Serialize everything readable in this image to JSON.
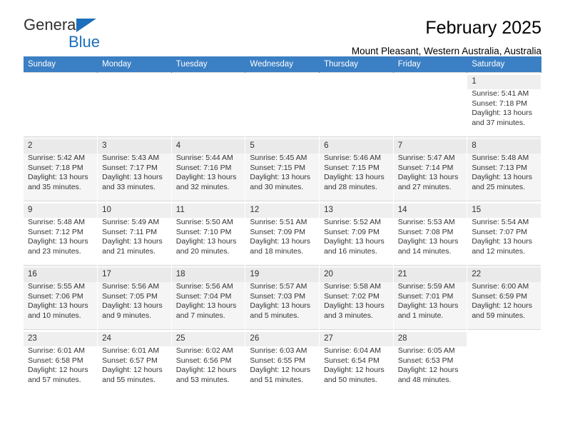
{
  "brand": {
    "name_top": "General",
    "name_bottom": "Blue",
    "logo_icon": "triangle-flag-icon",
    "accent_color": "#1c6fba"
  },
  "header": {
    "title": "February 2025",
    "subtitle": "Mount Pleasant, Western Australia, Australia"
  },
  "calendar": {
    "header_background": "#3b7fc4",
    "weekday_headers": [
      "Sunday",
      "Monday",
      "Tuesday",
      "Wednesday",
      "Thursday",
      "Friday",
      "Saturday"
    ],
    "labels": {
      "sunrise": "Sunrise:",
      "sunset": "Sunset:",
      "daylight": "Daylight:"
    },
    "weeks": [
      [
        {
          "day": "",
          "empty": true
        },
        {
          "day": "",
          "empty": true
        },
        {
          "day": "",
          "empty": true
        },
        {
          "day": "",
          "empty": true
        },
        {
          "day": "",
          "empty": true
        },
        {
          "day": "",
          "empty": true
        },
        {
          "day": "1",
          "sunrise": "Sunrise: 5:41 AM",
          "sunset": "Sunset: 7:18 PM",
          "daylight_line1": "Daylight: 13 hours",
          "daylight_line2": "and 37 minutes."
        }
      ],
      [
        {
          "day": "2",
          "sunrise": "Sunrise: 5:42 AM",
          "sunset": "Sunset: 7:18 PM",
          "daylight_line1": "Daylight: 13 hours",
          "daylight_line2": "and 35 minutes."
        },
        {
          "day": "3",
          "sunrise": "Sunrise: 5:43 AM",
          "sunset": "Sunset: 7:17 PM",
          "daylight_line1": "Daylight: 13 hours",
          "daylight_line2": "and 33 minutes."
        },
        {
          "day": "4",
          "sunrise": "Sunrise: 5:44 AM",
          "sunset": "Sunset: 7:16 PM",
          "daylight_line1": "Daylight: 13 hours",
          "daylight_line2": "and 32 minutes."
        },
        {
          "day": "5",
          "sunrise": "Sunrise: 5:45 AM",
          "sunset": "Sunset: 7:15 PM",
          "daylight_line1": "Daylight: 13 hours",
          "daylight_line2": "and 30 minutes."
        },
        {
          "day": "6",
          "sunrise": "Sunrise: 5:46 AM",
          "sunset": "Sunset: 7:15 PM",
          "daylight_line1": "Daylight: 13 hours",
          "daylight_line2": "and 28 minutes."
        },
        {
          "day": "7",
          "sunrise": "Sunrise: 5:47 AM",
          "sunset": "Sunset: 7:14 PM",
          "daylight_line1": "Daylight: 13 hours",
          "daylight_line2": "and 27 minutes."
        },
        {
          "day": "8",
          "sunrise": "Sunrise: 5:48 AM",
          "sunset": "Sunset: 7:13 PM",
          "daylight_line1": "Daylight: 13 hours",
          "daylight_line2": "and 25 minutes."
        }
      ],
      [
        {
          "day": "9",
          "sunrise": "Sunrise: 5:48 AM",
          "sunset": "Sunset: 7:12 PM",
          "daylight_line1": "Daylight: 13 hours",
          "daylight_line2": "and 23 minutes."
        },
        {
          "day": "10",
          "sunrise": "Sunrise: 5:49 AM",
          "sunset": "Sunset: 7:11 PM",
          "daylight_line1": "Daylight: 13 hours",
          "daylight_line2": "and 21 minutes."
        },
        {
          "day": "11",
          "sunrise": "Sunrise: 5:50 AM",
          "sunset": "Sunset: 7:10 PM",
          "daylight_line1": "Daylight: 13 hours",
          "daylight_line2": "and 20 minutes."
        },
        {
          "day": "12",
          "sunrise": "Sunrise: 5:51 AM",
          "sunset": "Sunset: 7:09 PM",
          "daylight_line1": "Daylight: 13 hours",
          "daylight_line2": "and 18 minutes."
        },
        {
          "day": "13",
          "sunrise": "Sunrise: 5:52 AM",
          "sunset": "Sunset: 7:09 PM",
          "daylight_line1": "Daylight: 13 hours",
          "daylight_line2": "and 16 minutes."
        },
        {
          "day": "14",
          "sunrise": "Sunrise: 5:53 AM",
          "sunset": "Sunset: 7:08 PM",
          "daylight_line1": "Daylight: 13 hours",
          "daylight_line2": "and 14 minutes."
        },
        {
          "day": "15",
          "sunrise": "Sunrise: 5:54 AM",
          "sunset": "Sunset: 7:07 PM",
          "daylight_line1": "Daylight: 13 hours",
          "daylight_line2": "and 12 minutes."
        }
      ],
      [
        {
          "day": "16",
          "sunrise": "Sunrise: 5:55 AM",
          "sunset": "Sunset: 7:06 PM",
          "daylight_line1": "Daylight: 13 hours",
          "daylight_line2": "and 10 minutes."
        },
        {
          "day": "17",
          "sunrise": "Sunrise: 5:56 AM",
          "sunset": "Sunset: 7:05 PM",
          "daylight_line1": "Daylight: 13 hours",
          "daylight_line2": "and 9 minutes."
        },
        {
          "day": "18",
          "sunrise": "Sunrise: 5:56 AM",
          "sunset": "Sunset: 7:04 PM",
          "daylight_line1": "Daylight: 13 hours",
          "daylight_line2": "and 7 minutes."
        },
        {
          "day": "19",
          "sunrise": "Sunrise: 5:57 AM",
          "sunset": "Sunset: 7:03 PM",
          "daylight_line1": "Daylight: 13 hours",
          "daylight_line2": "and 5 minutes."
        },
        {
          "day": "20",
          "sunrise": "Sunrise: 5:58 AM",
          "sunset": "Sunset: 7:02 PM",
          "daylight_line1": "Daylight: 13 hours",
          "daylight_line2": "and 3 minutes."
        },
        {
          "day": "21",
          "sunrise": "Sunrise: 5:59 AM",
          "sunset": "Sunset: 7:01 PM",
          "daylight_line1": "Daylight: 13 hours",
          "daylight_line2": "and 1 minute."
        },
        {
          "day": "22",
          "sunrise": "Sunrise: 6:00 AM",
          "sunset": "Sunset: 6:59 PM",
          "daylight_line1": "Daylight: 12 hours",
          "daylight_line2": "and 59 minutes."
        }
      ],
      [
        {
          "day": "23",
          "sunrise": "Sunrise: 6:01 AM",
          "sunset": "Sunset: 6:58 PM",
          "daylight_line1": "Daylight: 12 hours",
          "daylight_line2": "and 57 minutes."
        },
        {
          "day": "24",
          "sunrise": "Sunrise: 6:01 AM",
          "sunset": "Sunset: 6:57 PM",
          "daylight_line1": "Daylight: 12 hours",
          "daylight_line2": "and 55 minutes."
        },
        {
          "day": "25",
          "sunrise": "Sunrise: 6:02 AM",
          "sunset": "Sunset: 6:56 PM",
          "daylight_line1": "Daylight: 12 hours",
          "daylight_line2": "and 53 minutes."
        },
        {
          "day": "26",
          "sunrise": "Sunrise: 6:03 AM",
          "sunset": "Sunset: 6:55 PM",
          "daylight_line1": "Daylight: 12 hours",
          "daylight_line2": "and 51 minutes."
        },
        {
          "day": "27",
          "sunrise": "Sunrise: 6:04 AM",
          "sunset": "Sunset: 6:54 PM",
          "daylight_line1": "Daylight: 12 hours",
          "daylight_line2": "and 50 minutes."
        },
        {
          "day": "28",
          "sunrise": "Sunrise: 6:05 AM",
          "sunset": "Sunset: 6:53 PM",
          "daylight_line1": "Daylight: 12 hours",
          "daylight_line2": "and 48 minutes."
        },
        {
          "day": "",
          "empty": true
        }
      ]
    ]
  }
}
